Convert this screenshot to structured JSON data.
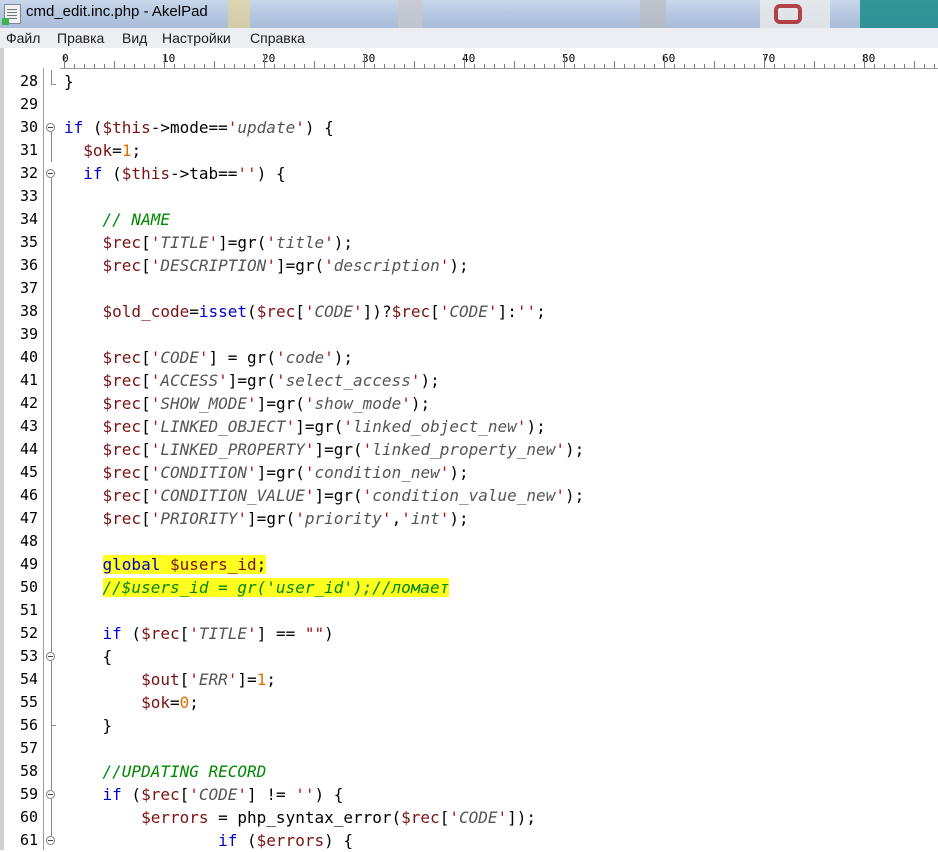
{
  "window": {
    "title": "cmd_edit.inc.php - AkelPad"
  },
  "menu": [
    "Файл",
    "Правка",
    "Вид",
    "Настройки",
    "Справка"
  ],
  "ruler": {
    "labels": [
      "0",
      "10",
      "20",
      "30",
      "40",
      "50",
      "60",
      "70",
      "80"
    ]
  },
  "editor": {
    "line_numbers": [
      "28",
      "29",
      "30",
      "31",
      "32",
      "33",
      "34",
      "35",
      "36",
      "37",
      "38",
      "39",
      "40",
      "41",
      "42",
      "43",
      "44",
      "45",
      "46",
      "47",
      "48",
      "49",
      "50",
      "51",
      "52",
      "53",
      "54",
      "55",
      "56",
      "57",
      "58",
      "59",
      "60",
      "61"
    ],
    "lines": [
      "}",
      "",
      "if ($this->mode=='update') {",
      "  $ok=1;",
      "  if ($this->tab=='') {",
      "",
      "    // NAME",
      "    $rec['TITLE']=gr('title');",
      "    $rec['DESCRIPTION']=gr('description');",
      "",
      "    $old_code=isset($rec['CODE'])?$rec['CODE']:'';",
      "",
      "    $rec['CODE'] = gr('code');",
      "    $rec['ACCESS']=gr('select_access');",
      "    $rec['SHOW_MODE']=gr('show_mode');",
      "    $rec['LINKED_OBJECT']=gr('linked_object_new');",
      "    $rec['LINKED_PROPERTY']=gr('linked_property_new');",
      "    $rec['CONDITION']=gr('condition_new');",
      "    $rec['CONDITION_VALUE']=gr('condition_value_new');",
      "    $rec['PRIORITY']=gr('priority','int');",
      "",
      "    global $users_id;",
      "    //$users_id = gr('user_id');//ломает",
      "",
      "    if ($rec['TITLE'] == \"\")",
      "    {",
      "        $out['ERR']=1;",
      "        $ok=0;",
      "    }",
      "",
      "    //UPDATING RECORD",
      "    if ($rec['CODE'] != '') {",
      "        $errors = php_syntax_error($rec['CODE']);",
      "                if ($errors) {"
    ],
    "highlighted_lines": [
      "49",
      "50"
    ]
  },
  "colors": {
    "keyword": "#0000cc",
    "variable": "#7a1212",
    "string": "#555555",
    "quote": "#b01010",
    "number": "#e07000",
    "comment": "#008800",
    "highlight": "#ffff20"
  }
}
